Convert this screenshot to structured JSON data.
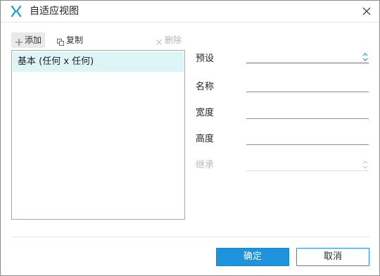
{
  "window": {
    "title": "自适应视图",
    "logo_icon": "axure-x-icon",
    "close_icon": "close-icon"
  },
  "toolbar": {
    "add_label": "添加",
    "copy_label": "复制",
    "delete_label": "删除"
  },
  "views": {
    "items": [
      {
        "label": "基本 (任何 x 任何)",
        "selected": true
      }
    ]
  },
  "form": {
    "preset_label": "预设",
    "preset_value": "",
    "name_label": "名称",
    "name_value": "",
    "width_label": "宽度",
    "width_value": "",
    "height_label": "高度",
    "height_value": "",
    "inherit_label": "继承",
    "inherit_value": ""
  },
  "buttons": {
    "ok_label": "确定",
    "cancel_label": "取消"
  },
  "colors": {
    "accent": "#1e93dc",
    "selection": "#ddf5f7",
    "logo": "#1a9ad6"
  }
}
